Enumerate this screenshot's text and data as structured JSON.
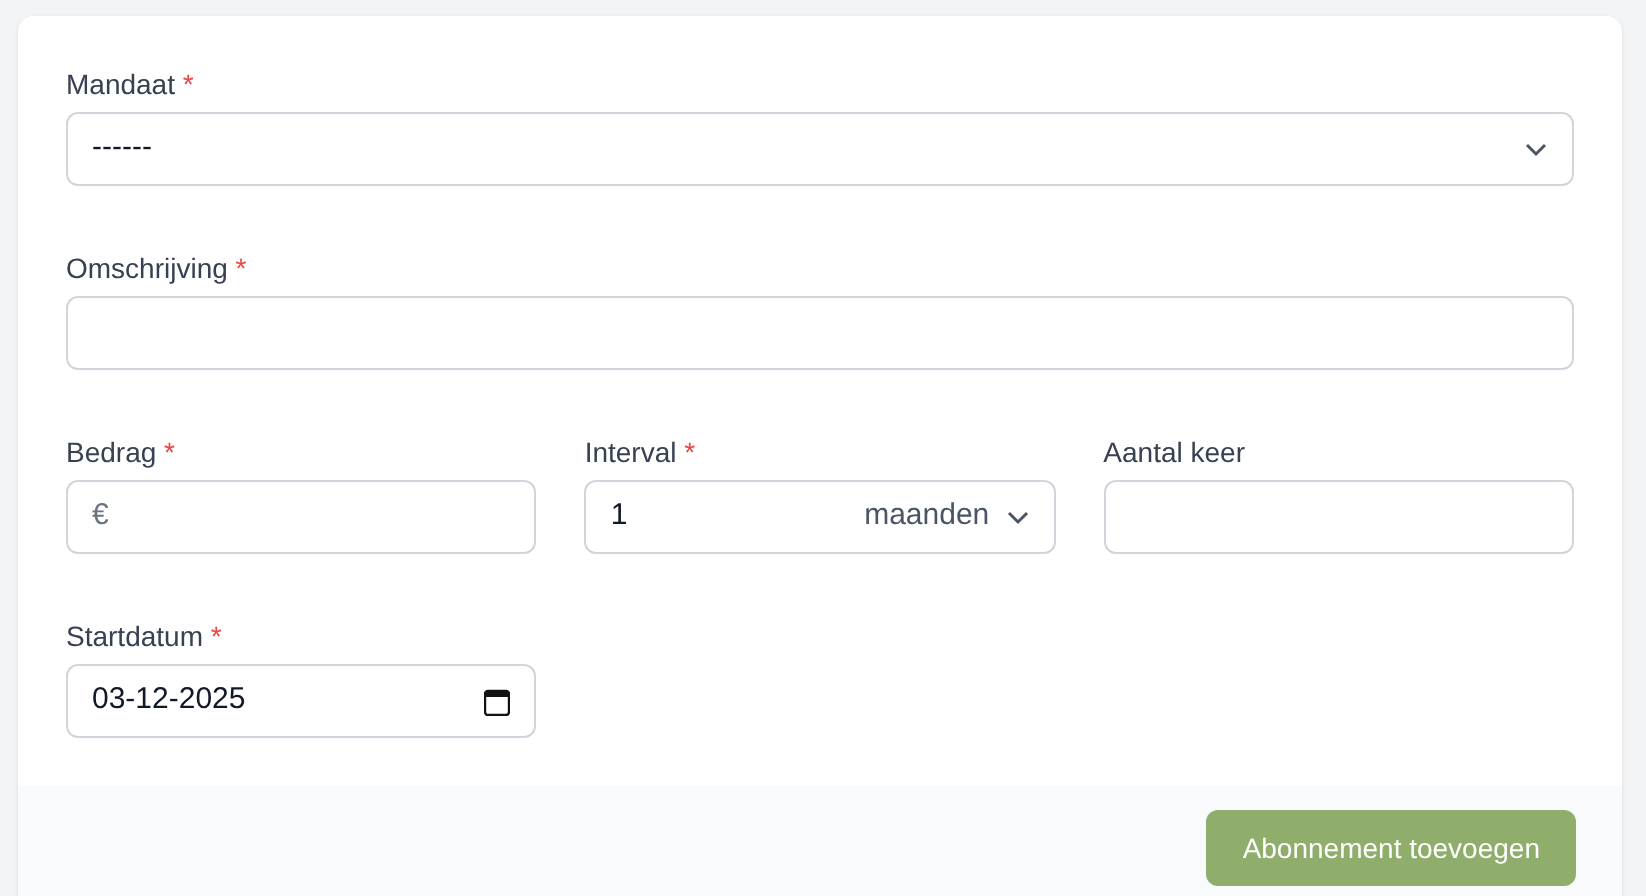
{
  "fields": [
    {
      "kind": "select",
      "label": "Mandaat",
      "required_mark": "*",
      "full_width": true,
      "value": "------"
    },
    {
      "kind": "text",
      "label": "Omschrijving",
      "required_mark": "*",
      "full_width": true
    },
    {
      "kind": "money",
      "label": "Bedrag",
      "required_mark": "*",
      "full_width": false,
      "prefix": "€"
    },
    {
      "kind": "interval",
      "label": "Interval",
      "required_mark": "*",
      "full_width": false,
      "value": "1",
      "unit": "maanden"
    },
    {
      "kind": "number",
      "label": "Aantal keer",
      "full_width": false
    },
    {
      "kind": "date",
      "label": "Startdatum",
      "required_mark": "*",
      "full_width": false,
      "value": "03-12-2025"
    }
  ],
  "submit_button": "Abonnement toevoegen"
}
